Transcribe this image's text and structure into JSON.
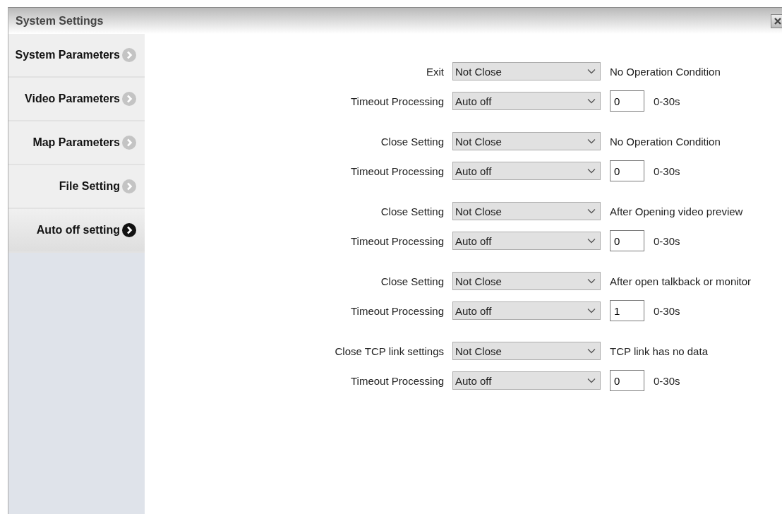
{
  "window": {
    "title": "System Settings"
  },
  "sidebar": {
    "items": [
      {
        "label": "System Parameters",
        "selected": false
      },
      {
        "label": "Video Parameters",
        "selected": false
      },
      {
        "label": "Map Parameters",
        "selected": false
      },
      {
        "label": "File Setting",
        "selected": false
      },
      {
        "label": "Auto off setting",
        "selected": true
      }
    ]
  },
  "groups": [
    {
      "close": {
        "label": "Exit",
        "option": "Not Close",
        "condition": "No Operation Condition"
      },
      "timeout": {
        "label": "Timeout Processing",
        "option": "Auto off",
        "value": "0",
        "range": "0-30s"
      }
    },
    {
      "close": {
        "label": "Close Setting",
        "option": "Not Close",
        "condition": "No Operation Condition"
      },
      "timeout": {
        "label": "Timeout Processing",
        "option": "Auto off",
        "value": "0",
        "range": "0-30s"
      }
    },
    {
      "close": {
        "label": "Close Setting",
        "option": "Not Close",
        "condition": "After Opening video preview"
      },
      "timeout": {
        "label": "Timeout Processing",
        "option": "Auto off",
        "value": "0",
        "range": "0-30s"
      }
    },
    {
      "close": {
        "label": "Close Setting",
        "option": "Not Close",
        "condition": "After open talkback or monitor"
      },
      "timeout": {
        "label": "Timeout Processing",
        "option": "Auto off",
        "value": "1",
        "range": "0-30s"
      }
    },
    {
      "close": {
        "label": "Close TCP link settings",
        "option": "Not Close",
        "condition": "TCP link has no data"
      },
      "timeout": {
        "label": "Timeout Processing",
        "option": "Auto off",
        "value": "0",
        "range": "0-30s"
      }
    }
  ]
}
